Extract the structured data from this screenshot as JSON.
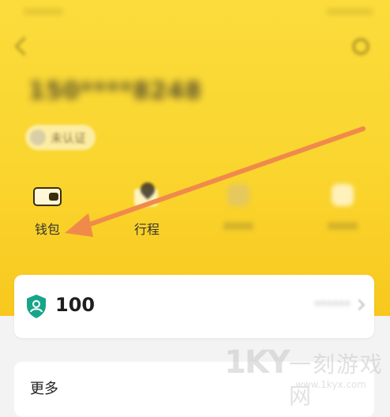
{
  "status_bar": {
    "left": "••••••",
    "right": "•••••••"
  },
  "profile": {
    "phone": "150****8248",
    "certification": "未认证"
  },
  "menu": {
    "items": [
      {
        "label": "钱包",
        "icon": "wallet-icon"
      },
      {
        "label": "行程",
        "icon": "trip-icon"
      },
      {
        "label": "••••",
        "icon": "blurred-icon"
      },
      {
        "label": "••••",
        "icon": "blurred-icon"
      }
    ]
  },
  "points_card": {
    "value": "100",
    "right_text": "••••••",
    "icon": "shield-user-icon",
    "icon_color": "#17a589"
  },
  "more_section": {
    "title": "更多"
  },
  "watermark": {
    "logo": "1KY",
    "name": "一刻游戏网",
    "url": "www.1kyx.com"
  },
  "colors": {
    "header": "#fad52e",
    "arrow": "#f08a4b"
  }
}
